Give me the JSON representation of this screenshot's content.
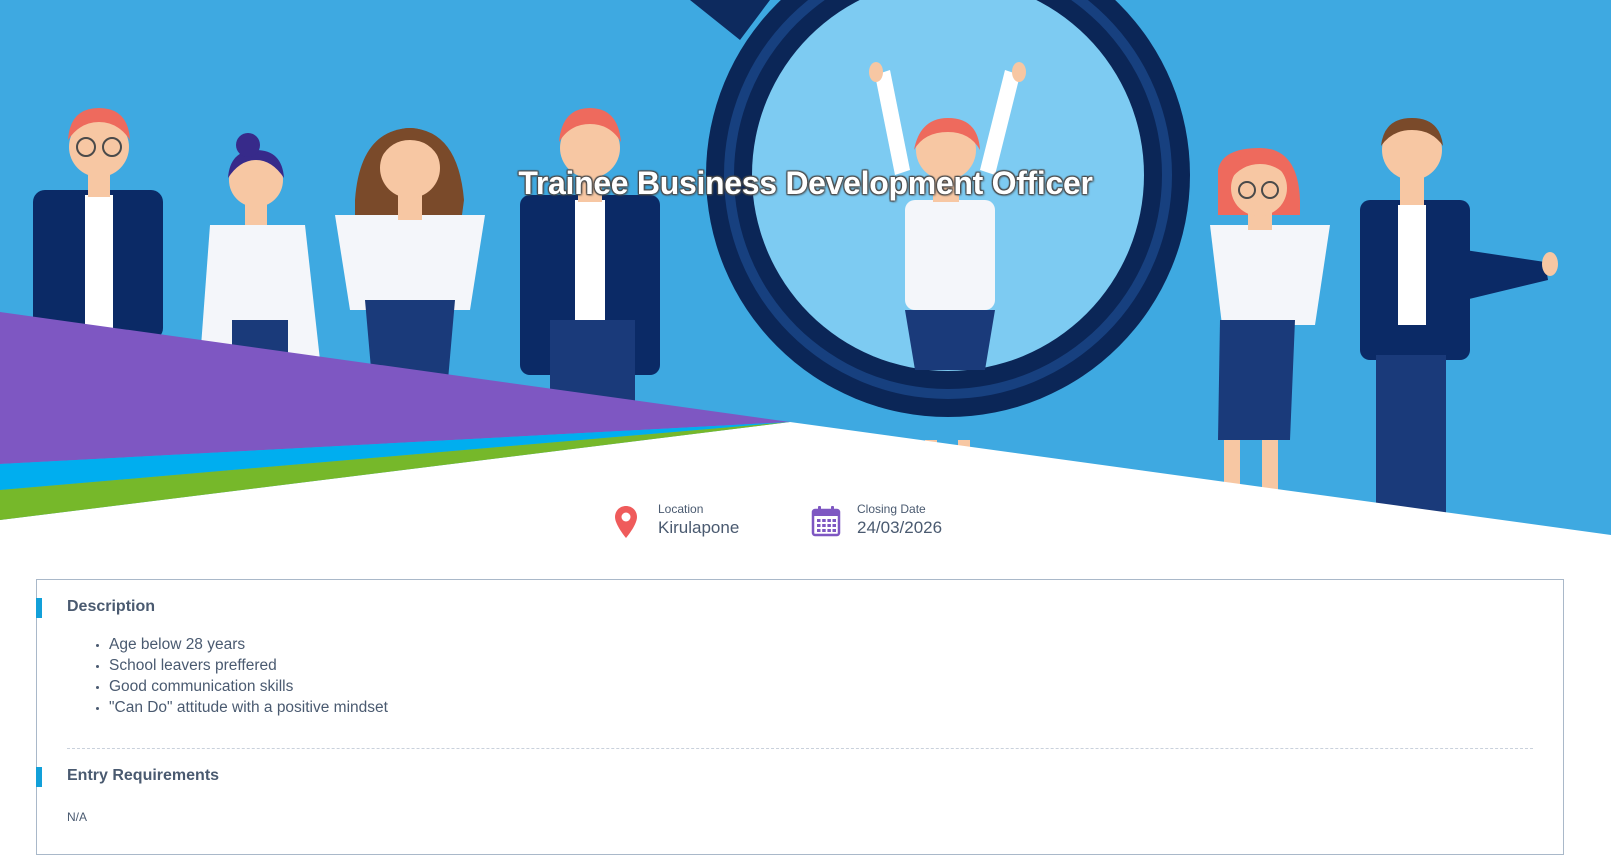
{
  "job": {
    "title": "Trainee Business Development Officer"
  },
  "meta": {
    "location": {
      "label": "Location",
      "value": "Kirulapone",
      "icon": "map-pin-icon"
    },
    "closing_date": {
      "label": "Closing Date",
      "value": "24/03/2026",
      "icon": "calendar-icon"
    }
  },
  "description": {
    "title": "Description",
    "items": [
      "Age below 28 years",
      "School leavers preffered",
      "Good communication skills",
      "\"Can Do\" attitude with a positive mindset"
    ]
  },
  "entry_requirements": {
    "title": "Entry Requirements",
    "value": "N/A"
  },
  "colors": {
    "hero_sky": "#3ea9e1",
    "accent_purple": "#7e57c2",
    "accent_cyan": "#00aeef",
    "accent_green": "#76b82a",
    "section_bar": "#12a0d9",
    "pin": "#ef5b5b",
    "calendar": "#7e57c2",
    "text": "#4a5a70"
  }
}
